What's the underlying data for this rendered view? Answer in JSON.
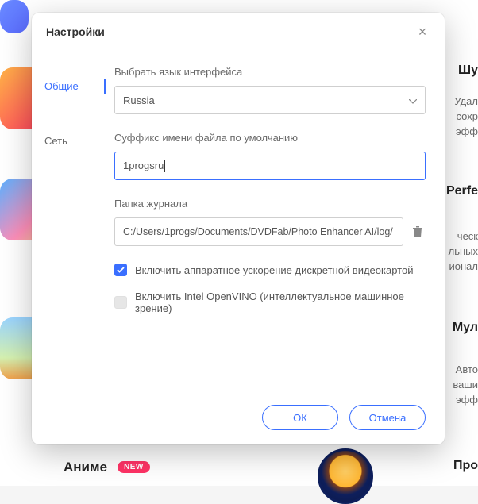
{
  "dialog": {
    "title": "Настройки",
    "close_label": "×"
  },
  "sidebar": {
    "items": [
      {
        "label": "Общие",
        "active": true
      },
      {
        "label": "Сеть",
        "active": false
      }
    ]
  },
  "content": {
    "language_label": "Выбрать язык интерфейса",
    "language_value": "Russia",
    "suffix_label": "Суффикс имени файла по умолчанию",
    "suffix_value": "1progsru",
    "logfolder_label": "Папка журнала",
    "logfolder_value": "C:/Users/1progs/Documents/DVDFab/Photo Enhancer AI/log/",
    "hwaccel_label": "Включить аппаратное ускорение дискретной видеокартой",
    "hwaccel_checked": true,
    "openvino_label": "Включить Intel OpenVINO (интеллектуальное машинное зрение)",
    "openvino_checked": false
  },
  "footer": {
    "ok_label": "ОК",
    "cancel_label": "Отмена"
  },
  "background": {
    "anime_label": "Аниме",
    "new_badge": "NEW",
    "right1_title": "Шу",
    "right1_desc1": "Удал",
    "right1_desc2": "сохр",
    "right1_desc3": "эфф",
    "right2_title": "Perfe",
    "right2_desc1": "ческ",
    "right2_desc2": "льных",
    "right2_desc3": "ионал",
    "right3_title": "Мул",
    "right3_desc1": "Авто",
    "right3_desc2": "ваши",
    "right3_desc3": "эфф",
    "right4_title": "Про"
  }
}
